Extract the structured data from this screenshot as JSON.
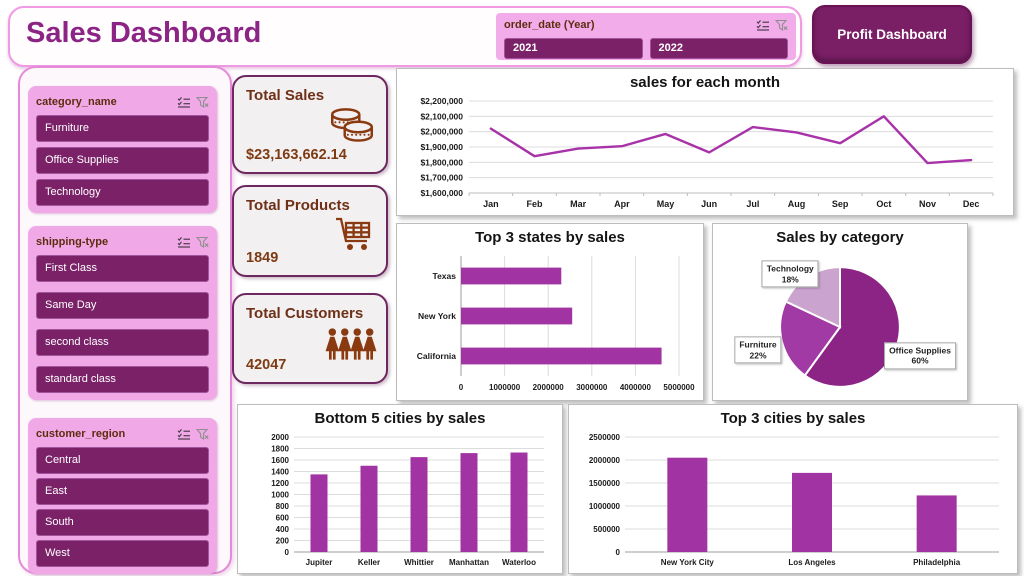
{
  "header": {
    "title": "Sales Dashboard",
    "profit_button": "Profit Dashboard",
    "year_slicer": {
      "label": "order_date (Year)",
      "items": [
        "2021",
        "2022"
      ]
    }
  },
  "sidebar": {
    "slicers": [
      {
        "label": "category_name",
        "items": [
          "Furniture",
          "Office Supplies",
          "Technology"
        ]
      },
      {
        "label": "shipping-type",
        "items": [
          "First Class",
          "Same Day",
          "second class",
          "standard class"
        ]
      },
      {
        "label": "customer_region",
        "items": [
          "Central",
          "East",
          "South",
          "West"
        ]
      }
    ]
  },
  "kpis": [
    {
      "label": "Total Sales",
      "value": "$23,163,662.14",
      "icon": "coins-icon"
    },
    {
      "label": "Total Products",
      "value": "1849",
      "icon": "cart-icon"
    },
    {
      "label": "Total Customers",
      "value": "42047",
      "icon": "people-icon"
    }
  ],
  "colors": {
    "accent_dark_purple": "#7b2168",
    "title_purple": "#8b2484",
    "series_magenta": "#a832a8",
    "pink_panel": "#f0a9e6",
    "kpi_brown": "#8a3a10"
  },
  "chart_data": [
    {
      "id": "monthly-sales",
      "type": "line",
      "title": "sales for each month",
      "categories": [
        "Jan",
        "Feb",
        "Mar",
        "Apr",
        "May",
        "Jun",
        "Jul",
        "Aug",
        "Sep",
        "Oct",
        "Nov",
        "Dec"
      ],
      "values": [
        2020000,
        1840000,
        1890000,
        1905000,
        1985000,
        1865000,
        2030000,
        1995000,
        1925000,
        2100000,
        1795000,
        1815000
      ],
      "ylim": [
        1600000,
        2200000
      ],
      "ytick": 100000,
      "yformat": "usd",
      "grid": true,
      "line_color": "#a832a8"
    },
    {
      "id": "top-states",
      "type": "bar-h",
      "title": "Top 3 states by sales",
      "categories": [
        "Texas",
        "New York",
        "California"
      ],
      "values": [
        2300000,
        2550000,
        4600000
      ],
      "xlim": [
        0,
        5000000
      ],
      "xtick": 1000000,
      "grid": true,
      "bar_color": "#a233a2"
    },
    {
      "id": "sales-by-category",
      "type": "pie",
      "title": "Sales by category",
      "slices": [
        {
          "label": "Office Supplies",
          "pct": 60,
          "color": "#8b2484"
        },
        {
          "label": "Furniture",
          "pct": 22,
          "color": "#a23aa6"
        },
        {
          "label": "Technology",
          "pct": 18,
          "color": "#cba3cf"
        }
      ]
    },
    {
      "id": "bottom-cities",
      "type": "bar-v",
      "title": "Bottom 5 cities by sales",
      "categories": [
        "Jupiter",
        "Keller",
        "Whittier",
        "Manhattan",
        "Waterloo"
      ],
      "values": [
        1350,
        1500,
        1650,
        1720,
        1730
      ],
      "ylim": [
        0,
        2000
      ],
      "ytick": 200,
      "grid": true,
      "bar_color": "#a233a2"
    },
    {
      "id": "top-cities",
      "type": "bar-v",
      "title": "Top 3 cities by sales",
      "categories": [
        "New York City",
        "Los Angeles",
        "Philadelphia"
      ],
      "values": [
        2050000,
        1720000,
        1230000
      ],
      "ylim": [
        0,
        2500000
      ],
      "ytick": 500000,
      "grid": true,
      "bar_color": "#a233a2"
    }
  ]
}
